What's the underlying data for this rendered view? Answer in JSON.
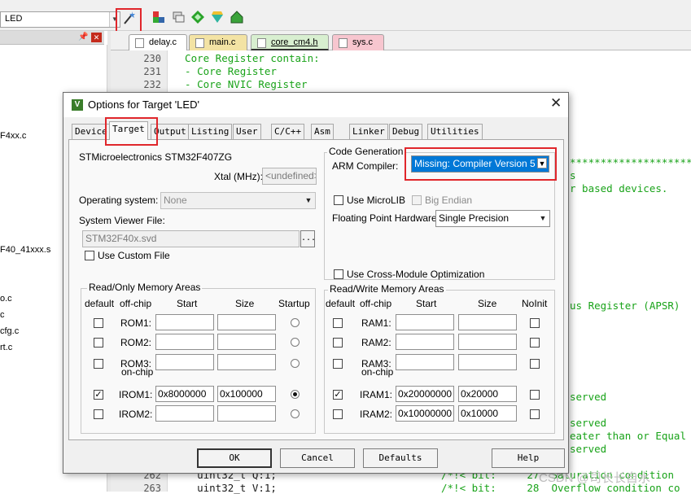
{
  "ide": {
    "target_name": "LED",
    "project_files": [
      "F4xx.c",
      "F40_41xxx.s",
      "o.c",
      "c",
      "cfg.c",
      "rt.c"
    ],
    "file_tabs": [
      {
        "label": "delay.c",
        "color": "#ffffff"
      },
      {
        "label": "main.c",
        "color": "#f3e3a4"
      },
      {
        "label": "core_cm4.h",
        "color": "#d8efd0"
      },
      {
        "label": "sys.c",
        "color": "#f7c6cf"
      }
    ],
    "code_lines": [
      {
        "num": "230",
        "text": "  Core Register contain:"
      },
      {
        "num": "231",
        "text": "  - Core Register"
      },
      {
        "num": "232",
        "text": "  - Core NVIC Register"
      }
    ],
    "right_fragments": [
      "*********************/",
      "s",
      "r based devices.",
      "us Register (APSR)",
      "served",
      "served",
      "eater than or Equal",
      "served"
    ],
    "bottom_lines": [
      {
        "num": "262",
        "text": "    uint32_t Q:1;",
        "comment": "/*!< bit:     27  Saturation condition"
      },
      {
        "num": "263",
        "text": "    uint32_t V:1;",
        "comment": "/*!< bit:     28  Overflow condition co"
      }
    ],
    "watermark": "CSDN @司长长自水"
  },
  "dialog": {
    "title": "Options for Target 'LED'",
    "tabs": [
      "Device",
      "Target",
      "Output",
      "Listing",
      "User",
      "C/C++",
      "Asm",
      "Linker",
      "Debug",
      "Utilities"
    ],
    "active_tab": "Target",
    "device_name": "STMicroelectronics STM32F407ZG",
    "xtal_label": "Xtal (MHz):",
    "xtal_value": "<undefined>",
    "os_label": "Operating system:",
    "os_value": "None",
    "svd_label": "System Viewer File:",
    "svd_value": "STM32F40x.svd",
    "svd_browse": "...",
    "use_custom_file": "Use Custom File",
    "codegen": {
      "title": "Code Generation",
      "arm_compiler_label": "ARM Compiler:",
      "arm_compiler_value": "Missing: Compiler Version 5",
      "use_microlib": "Use MicroLIB",
      "big_endian": "Big Endian",
      "fph_label": "Floating Point Hardware:",
      "fph_value": "Single Precision",
      "cross_module": "Use Cross-Module Optimization"
    },
    "ro_mem": {
      "title": "Read/Only Memory Areas",
      "headers": [
        "default",
        "off-chip",
        "Start",
        "Size",
        "Startup"
      ],
      "onchip_label": "on-chip",
      "rows": [
        {
          "name": "ROM1:",
          "start": "",
          "size": "",
          "default": false,
          "startup": false
        },
        {
          "name": "ROM2:",
          "start": "",
          "size": "",
          "default": false,
          "startup": false
        },
        {
          "name": "ROM3:",
          "start": "",
          "size": "",
          "default": false,
          "startup": false
        },
        {
          "name": "IROM1:",
          "start": "0x8000000",
          "size": "0x100000",
          "default": true,
          "startup": true
        },
        {
          "name": "IROM2:",
          "start": "",
          "size": "",
          "default": false,
          "startup": false
        }
      ]
    },
    "rw_mem": {
      "title": "Read/Write Memory Areas",
      "headers": [
        "default",
        "off-chip",
        "Start",
        "Size",
        "NoInit"
      ],
      "onchip_label": "on-chip",
      "rows": [
        {
          "name": "RAM1:",
          "start": "",
          "size": "",
          "default": false
        },
        {
          "name": "RAM2:",
          "start": "",
          "size": "",
          "default": false
        },
        {
          "name": "RAM3:",
          "start": "",
          "size": "",
          "default": false
        },
        {
          "name": "IRAM1:",
          "start": "0x20000000",
          "size": "0x20000",
          "default": true
        },
        {
          "name": "IRAM2:",
          "start": "0x10000000",
          "size": "0x10000",
          "default": false
        }
      ]
    },
    "buttons": {
      "ok": "OK",
      "cancel": "Cancel",
      "defaults": "Defaults",
      "help": "Help"
    }
  }
}
